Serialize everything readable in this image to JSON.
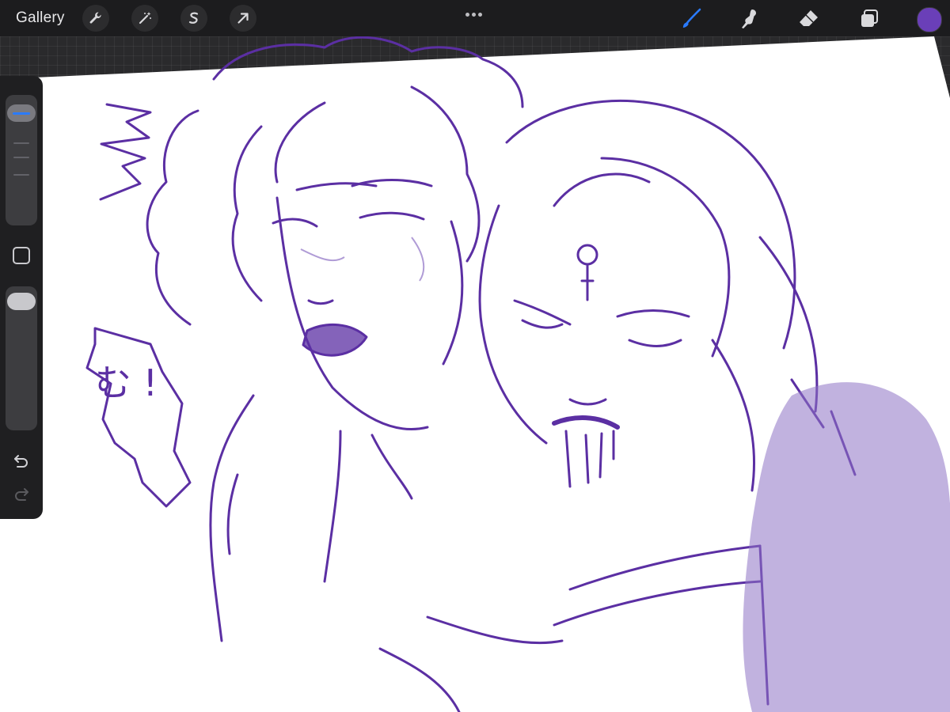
{
  "topbar": {
    "gallery_label": "Gallery",
    "left_tools": [
      "wrench-icon",
      "magic-wand-icon",
      "selection-icon",
      "transform-arrow-icon"
    ],
    "more_menu": "ellipsis-icon",
    "right_tools": [
      {
        "icon": "brush-icon",
        "active": true
      },
      {
        "icon": "smudge-icon",
        "active": false
      },
      {
        "icon": "eraser-icon",
        "active": false
      },
      {
        "icon": "layers-icon",
        "active": false
      }
    ],
    "current_color": "#6a3fb8"
  },
  "sidebar": {
    "brush_size_slider": "size",
    "opacity_slider": "opacity",
    "modify_button": "square-icon",
    "undo": "undo-icon",
    "redo": "redo-icon"
  },
  "colors": {
    "accent_blue": "#2a7bff",
    "ink_purple": "#5b2fa3",
    "wash_purple": "#8e72c4"
  },
  "canvas": {
    "speech_bubble_text": "む !"
  }
}
